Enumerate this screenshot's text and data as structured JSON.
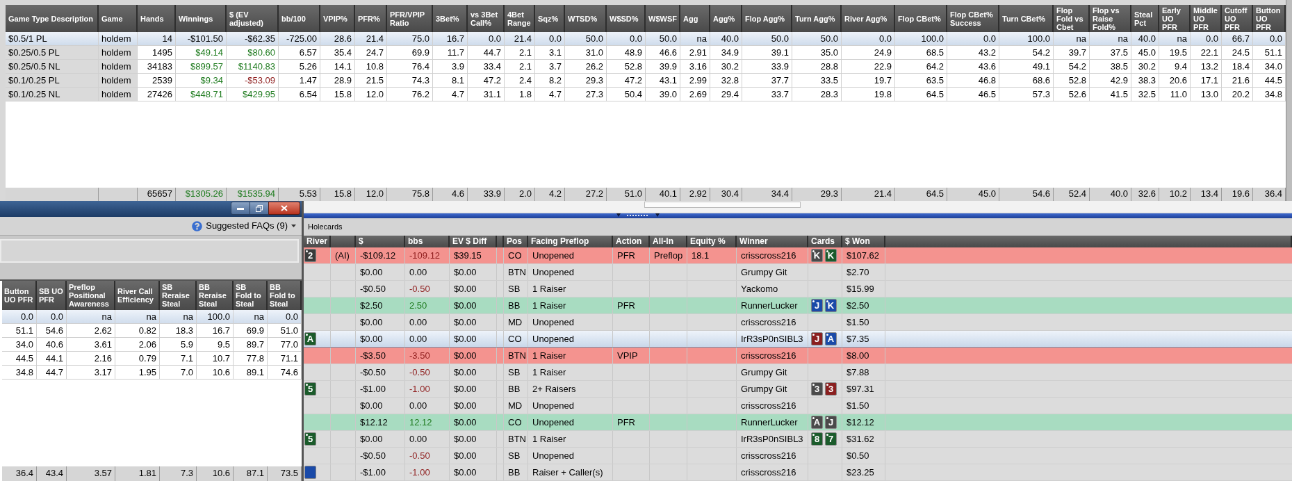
{
  "stats_table": {
    "columns": [
      "Game Type Description",
      "Game",
      "Hands",
      "Winnings",
      "$ (EV adjusted)",
      "bb/100",
      "VPIP%",
      "PFR%",
      "PFR/VPIP Ratio",
      "3Bet%",
      "vs 3Bet Call%",
      "4Bet Range",
      "Sqz%",
      "WTSD%",
      "W$SD%",
      "W$WSF",
      "Agg",
      "Agg%",
      "Flop Agg%",
      "Turn Agg%",
      "River Agg%",
      "Flop CBet%",
      "Flop CBet% Success",
      "Turn CBet%",
      "Flop Fold vs Cbet",
      "Flop vs Raise Fold%",
      "Steal Pct",
      "Early UO PFR",
      "Middle UO PFR",
      "Cutoff UO PFR",
      "Button UO PFR"
    ],
    "rows": [
      {
        "selected": true,
        "cells": [
          "$0.5/1 PL",
          "holdem",
          "14",
          "-$101.50",
          "-$62.35",
          "-725.00",
          "28.6",
          "21.4",
          "75.0",
          "16.7",
          "0.0",
          "21.4",
          "0.0",
          "50.0",
          "0.0",
          "50.0",
          "na",
          "40.0",
          "50.0",
          "50.0",
          "0.0",
          "100.0",
          "0.0",
          "100.0",
          "na",
          "na",
          "40.0",
          "na",
          "0.0",
          "66.7",
          "0.0"
        ]
      },
      {
        "selected": false,
        "cells": [
          "$0.25/0.5 PL",
          "holdem",
          "1495",
          {
            "text": "$49.14",
            "color": "#1e7b1e"
          },
          {
            "text": "$80.60",
            "color": "#1e7b1e"
          },
          "6.57",
          "35.4",
          "24.7",
          "69.9",
          "11.7",
          "44.7",
          "2.1",
          "3.1",
          "31.0",
          "48.9",
          "46.6",
          "2.91",
          "34.9",
          "39.1",
          "35.0",
          "24.9",
          "68.5",
          "43.2",
          "54.2",
          "39.7",
          "37.5",
          "45.0",
          "19.5",
          "22.1",
          "24.5",
          "51.1"
        ]
      },
      {
        "selected": false,
        "cells": [
          "$0.25/0.5 NL",
          "holdem",
          "34183",
          {
            "text": "$899.57",
            "color": "#1e7b1e"
          },
          {
            "text": "$1140.83",
            "color": "#1e7b1e"
          },
          "5.26",
          "14.1",
          "10.8",
          "76.4",
          "3.9",
          "33.4",
          "2.1",
          "3.7",
          "26.2",
          "52.8",
          "39.9",
          "3.16",
          "30.2",
          "33.9",
          "28.8",
          "22.9",
          "64.2",
          "43.6",
          "49.1",
          "54.2",
          "38.5",
          "30.2",
          "9.4",
          "13.2",
          "18.4",
          "34.0"
        ]
      },
      {
        "selected": false,
        "cells": [
          "$0.1/0.25 PL",
          "holdem",
          "2539",
          {
            "text": "$9.34",
            "color": "#1e7b1e"
          },
          {
            "text": "-$53.09",
            "color": "#8e1c1c"
          },
          "1.47",
          "28.9",
          "21.5",
          "74.3",
          "8.1",
          "47.2",
          "2.4",
          "8.2",
          "29.3",
          "47.2",
          "43.1",
          "2.99",
          "32.8",
          "37.7",
          "33.5",
          "19.7",
          "63.5",
          "46.8",
          "68.6",
          "52.8",
          "42.9",
          "38.3",
          "20.6",
          "17.1",
          "21.6",
          "44.5"
        ]
      },
      {
        "selected": false,
        "cells": [
          "$0.1/0.25 NL",
          "holdem",
          "27426",
          {
            "text": "$448.71",
            "color": "#1e7b1e"
          },
          {
            "text": "$429.95",
            "color": "#1e7b1e"
          },
          "6.54",
          "15.8",
          "12.0",
          "76.2",
          "4.7",
          "31.1",
          "1.8",
          "4.7",
          "27.3",
          "50.4",
          "39.0",
          "2.69",
          "29.4",
          "33.7",
          "28.3",
          "19.8",
          "64.5",
          "46.5",
          "57.3",
          "52.6",
          "41.5",
          "32.5",
          "11.0",
          "13.0",
          "20.2",
          "34.8"
        ]
      }
    ],
    "totals": [
      "65657",
      {
        "text": "$1305.26",
        "color": "#1e7b1e"
      },
      {
        "text": "$1535.94",
        "color": "#1e7b1e"
      },
      "5.53",
      "15.8",
      "12.0",
      "75.8",
      "4.6",
      "33.9",
      "2.0",
      "4.2",
      "27.2",
      "51.0",
      "40.1",
      "2.92",
      "30.4",
      "34.4",
      "29.3",
      "21.4",
      "64.5",
      "45.0",
      "54.6",
      "52.4",
      "40.0",
      "32.6",
      "10.2",
      "13.4",
      "19.6",
      "36.4"
    ]
  },
  "popup_window": {
    "help_menu": {
      "label": "Suggested FAQs (9)"
    },
    "table": {
      "columns": [
        "Button UO PFR",
        "SB UO PFR",
        "Preflop Positional Awareness",
        "River Call Efficiency",
        "SB Reraise Steal",
        "BB Reraise Steal",
        "SB Fold to Steal",
        "BB Fold to Steal"
      ],
      "rows": [
        {
          "selected": true,
          "cells": [
            "0.0",
            "0.0",
            "na",
            "na",
            "na",
            "100.0",
            "na",
            "0.0"
          ]
        },
        {
          "selected": false,
          "cells": [
            "51.1",
            "54.6",
            "2.62",
            "0.82",
            "18.3",
            "16.7",
            "69.9",
            "51.0"
          ]
        },
        {
          "selected": false,
          "cells": [
            "34.0",
            "40.6",
            "3.61",
            "2.06",
            "5.9",
            "9.5",
            "89.7",
            "77.0"
          ]
        },
        {
          "selected": false,
          "cells": [
            "44.5",
            "44.1",
            "2.16",
            "0.79",
            "7.1",
            "10.7",
            "77.8",
            "71.1"
          ]
        },
        {
          "selected": false,
          "cells": [
            "34.8",
            "44.7",
            "3.17",
            "1.95",
            "7.0",
            "10.6",
            "89.1",
            "74.6"
          ]
        }
      ],
      "totals": [
        "36.4",
        "43.4",
        "3.57",
        "1.81",
        "7.3",
        "10.6",
        "87.1",
        "73.5"
      ]
    }
  },
  "hands_panel": {
    "section_label": "Holecards",
    "columns": [
      "River",
      "$",
      "bbs",
      "EV $ Diff",
      "Pos",
      "Facing Preflop",
      "Action",
      "All-In",
      "Equity %",
      "Winner",
      "Cards",
      "$ Won"
    ],
    "rows": [
      {
        "color": "#f4938f",
        "selected": false,
        "river_card": {
          "rank": "2",
          "color": "#3a3a3a"
        },
        "note": "(AI)",
        "amount": "-$109.12",
        "bbs": {
          "text": "-109.12",
          "color": "#8e1c1c"
        },
        "ev_diff": "$39.15",
        "position": "CO",
        "facing_preflop": "Unopened",
        "action": "PFR",
        "all_in": "Preflop",
        "equity": "18.1",
        "winner": "crisscross216",
        "cards": [
          {
            "rank": "K",
            "color": "#4a4a4a"
          },
          {
            "rank": "K",
            "color": "#1b5b2b"
          }
        ],
        "won": "$107.62"
      },
      {
        "color": "#dcdcdc",
        "selected": false,
        "amount": "$0.00",
        "bbs": "0.00",
        "ev_diff": "$0.00",
        "position": "BTN",
        "facing_preflop": "Unopened",
        "winner": "Grumpy Git",
        "won": "$2.70"
      },
      {
        "color": "#dcdcdc",
        "selected": false,
        "amount": "-$0.50",
        "bbs": {
          "text": "-0.50",
          "color": "#8e1c1c"
        },
        "ev_diff": "$0.00",
        "position": "SB",
        "facing_preflop": "1 Raiser",
        "winner": "Yackomo",
        "won": "$15.99"
      },
      {
        "color": "#a8dcc1",
        "selected": false,
        "amount": "$2.50",
        "bbs": {
          "text": "2.50",
          "color": "#1e7b1e"
        },
        "ev_diff": "$0.00",
        "position": "BB",
        "facing_preflop": "1 Raiser",
        "action": "PFR",
        "winner": "RunnerLucker",
        "cards": [
          {
            "rank": "J",
            "color": "#1a4aa8"
          },
          {
            "rank": "K",
            "color": "#1a4aa8"
          }
        ],
        "won": "$2.50"
      },
      {
        "color": "#dcdcdc",
        "selected": false,
        "amount": "$0.00",
        "bbs": "0.00",
        "ev_diff": "$0.00",
        "position": "MD",
        "facing_preflop": "Unopened",
        "winner": "crisscross216",
        "won": "$1.50"
      },
      {
        "selected": true,
        "river_card": {
          "rank": "A",
          "color": "#1b5b2b"
        },
        "amount": "$0.00",
        "bbs": "0.00",
        "ev_diff": "$0.00",
        "position": "CO",
        "facing_preflop": "Unopened",
        "winner": "IrR3sP0nSIBL3",
        "cards": [
          {
            "rank": "J",
            "color": "#8a1f1f"
          },
          {
            "rank": "A",
            "color": "#1a4aa8"
          }
        ],
        "won": "$7.35"
      },
      {
        "color": "#f4938f",
        "selected": false,
        "amount": "-$3.50",
        "bbs": {
          "text": "-3.50",
          "color": "#8e1c1c"
        },
        "ev_diff": "$0.00",
        "position": "BTN",
        "facing_preflop": "1 Raiser",
        "action": "VPIP",
        "winner": "crisscross216",
        "won": "$8.00"
      },
      {
        "color": "#dcdcdc",
        "selected": false,
        "amount": "-$0.50",
        "bbs": {
          "text": "-0.50",
          "color": "#8e1c1c"
        },
        "ev_diff": "$0.00",
        "position": "SB",
        "facing_preflop": "1 Raiser",
        "winner": "Grumpy Git",
        "won": "$7.88"
      },
      {
        "color": "#dcdcdc",
        "selected": false,
        "river_card": {
          "rank": "5",
          "color": "#1b5b2b"
        },
        "amount": "-$1.00",
        "bbs": {
          "text": "-1.00",
          "color": "#8e1c1c"
        },
        "ev_diff": "$0.00",
        "position": "BB",
        "facing_preflop": "2+ Raisers",
        "winner": "Grumpy Git",
        "cards": [
          {
            "rank": "3",
            "color": "#4a4a4a"
          },
          {
            "rank": "3",
            "color": "#8a1f1f"
          }
        ],
        "won": "$97.31"
      },
      {
        "color": "#dcdcdc",
        "selected": false,
        "amount": "$0.00",
        "bbs": "0.00",
        "ev_diff": "$0.00",
        "position": "MD",
        "facing_preflop": "Unopened",
        "winner": "crisscross216",
        "won": "$1.50"
      },
      {
        "color": "#a8dcc1",
        "selected": false,
        "amount": "$12.12",
        "bbs": {
          "text": "12.12",
          "color": "#1e7b1e"
        },
        "ev_diff": "$0.00",
        "position": "CO",
        "facing_preflop": "Unopened",
        "action": "PFR",
        "winner": "RunnerLucker",
        "cards": [
          {
            "rank": "A",
            "color": "#4a4a4a"
          },
          {
            "rank": "J",
            "color": "#4a4a4a"
          }
        ],
        "won": "$12.12"
      },
      {
        "color": "#dcdcdc",
        "selected": false,
        "river_card": {
          "rank": "5",
          "color": "#1b5b2b"
        },
        "amount": "$0.00",
        "bbs": "0.00",
        "ev_diff": "$0.00",
        "position": "BTN",
        "facing_preflop": "1 Raiser",
        "winner": "IrR3sP0nSIBL3",
        "cards": [
          {
            "rank": "8",
            "color": "#1b5b2b"
          },
          {
            "rank": "7",
            "color": "#1b5b2b"
          }
        ],
        "won": "$31.62"
      },
      {
        "color": "#dcdcdc",
        "selected": false,
        "amount": "-$0.50",
        "bbs": {
          "text": "-0.50",
          "color": "#8e1c1c"
        },
        "ev_diff": "$0.00",
        "position": "SB",
        "facing_preflop": "Unopened",
        "winner": "crisscross216",
        "won": "$0.50"
      },
      {
        "color": "#dcdcdc",
        "selected": false,
        "river_card": {
          "color": "#1a4aa8"
        },
        "amount": "-$1.00",
        "bbs": {
          "text": "-1.00",
          "color": "#8e1c1c"
        },
        "ev_diff": "$0.00",
        "position": "BB",
        "facing_preflop": "Raiser + Caller(s)",
        "winner": "crisscross216",
        "won": "$23.25"
      }
    ]
  }
}
